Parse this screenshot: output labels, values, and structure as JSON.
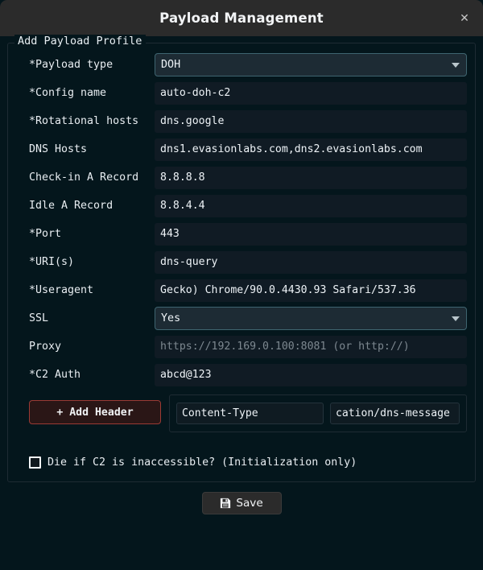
{
  "window": {
    "title": "Payload Management",
    "close_label": "✕"
  },
  "groupbox": {
    "title": "Add Payload Profile"
  },
  "form": {
    "rows": [
      {
        "label": "*Payload type",
        "type": "combo",
        "value": "DOH",
        "placeholder": ""
      },
      {
        "label": "*Config name",
        "type": "text",
        "value": "auto-doh-c2",
        "placeholder": ""
      },
      {
        "label": "*Rotational hosts",
        "type": "text",
        "value": "dns.google",
        "placeholder": ""
      },
      {
        "label": "DNS Hosts",
        "type": "text",
        "value": "dns1.evasionlabs.com,dns2.evasionlabs.com",
        "placeholder": ""
      },
      {
        "label": "Check-in A Record",
        "type": "text",
        "value": "8.8.8.8",
        "placeholder": ""
      },
      {
        "label": "Idle A Record",
        "type": "text",
        "value": "8.8.4.4",
        "placeholder": ""
      },
      {
        "label": "*Port",
        "type": "text",
        "value": "443",
        "placeholder": ""
      },
      {
        "label": "*URI(s)",
        "type": "text",
        "value": "dns-query",
        "placeholder": ""
      },
      {
        "label": "*Useragent",
        "type": "text",
        "value": "Gecko) Chrome/90.0.4430.93 Safari/537.36",
        "placeholder": ""
      },
      {
        "label": "SSL",
        "type": "combo",
        "value": "Yes",
        "placeholder": ""
      },
      {
        "label": "Proxy",
        "type": "text",
        "value": "",
        "placeholder": "https://192.169.0.100:8081 (or http://)"
      },
      {
        "label": "*C2 Auth",
        "type": "text",
        "value": "abcd@123",
        "placeholder": ""
      }
    ]
  },
  "headers": {
    "add_button_label": "+ Add Header",
    "entries": [
      {
        "key": "Content-Type",
        "value": "cation/dns-message"
      }
    ]
  },
  "checkbox": {
    "label": "Die if C2 is inaccessible? (Initialization only)",
    "checked": false
  },
  "footer": {
    "save_label": "Save"
  },
  "colors": {
    "window_background": "#04161c",
    "titlebar_background": "#2b2b2b",
    "input_background": "#101b24",
    "combo_border": "#3f6570",
    "add_header_border": "#9b3a34",
    "text_primary": "#eef3f7",
    "placeholder_text": "#7d8890"
  }
}
